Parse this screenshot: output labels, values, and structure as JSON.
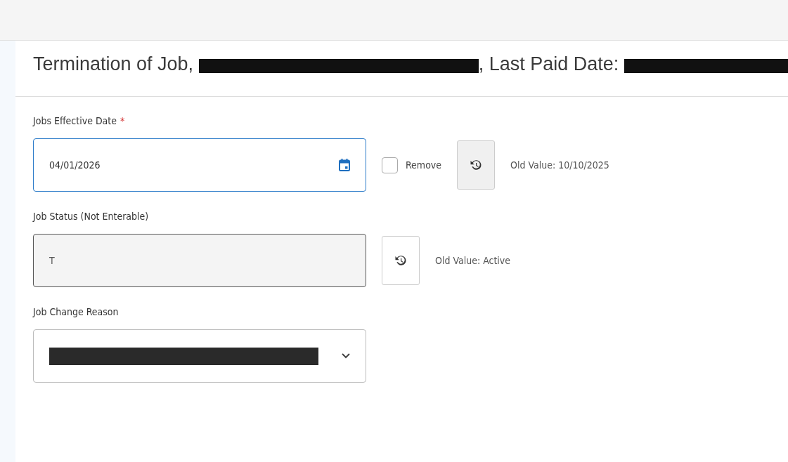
{
  "header": {
    "title_parts": [
      {
        "kind": "text",
        "text": "Termination of Job, "
      },
      {
        "kind": "redaction"
      },
      {
        "kind": "text",
        "text": ", Last Paid Date: "
      },
      {
        "kind": "redaction"
      }
    ]
  },
  "fields": [
    {
      "kind": "date",
      "label": "Jobs Effective Date",
      "required_mark": "*",
      "value": "04/01/2026",
      "focused": true,
      "remove": {
        "label": "Remove",
        "checked": false
      },
      "old_value": "Old Value: 10/10/2025"
    },
    {
      "kind": "readonly",
      "label": "Job Status (Not Enterable)",
      "value": "T",
      "disabled": true,
      "old_value": "Old Value: Active"
    },
    {
      "kind": "select",
      "label": "Job Change Reason",
      "value_redacted": true
    }
  ]
}
